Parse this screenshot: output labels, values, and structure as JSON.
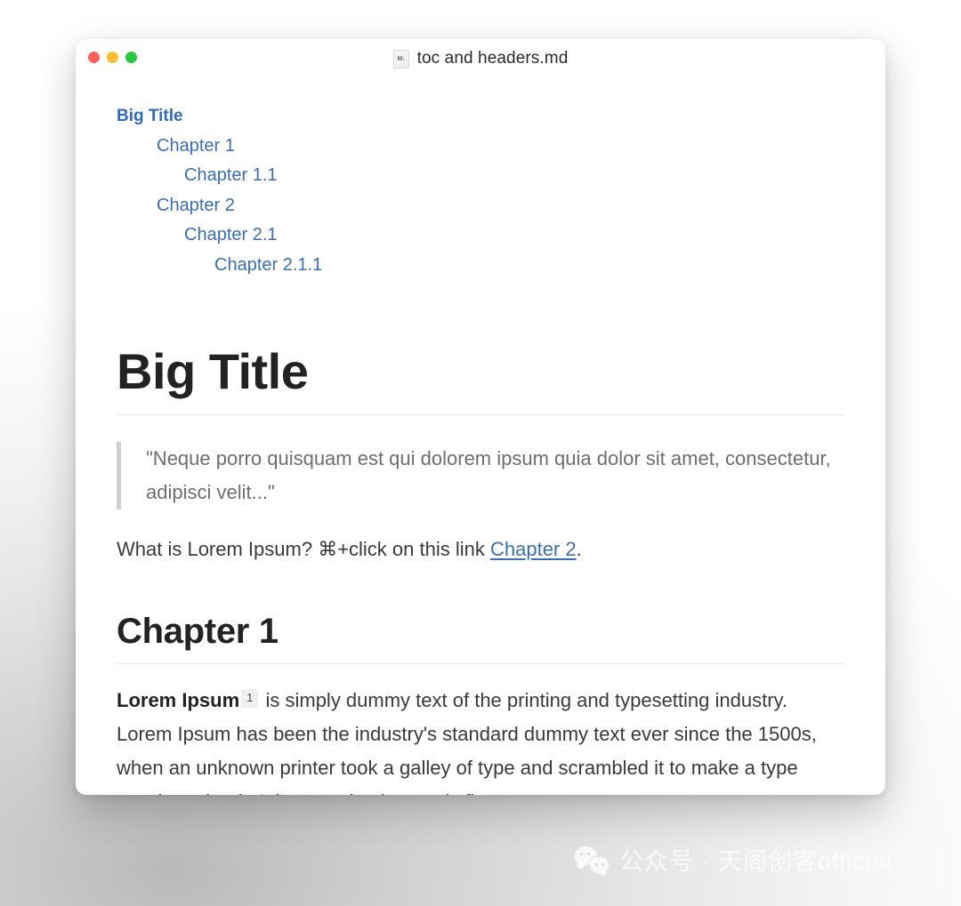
{
  "window": {
    "title": "toc and headers.md",
    "file_icon": "markdown-file-icon",
    "traffic_lights": [
      {
        "name": "close",
        "color": "#ff5f57"
      },
      {
        "name": "minimize",
        "color": "#febc2e"
      },
      {
        "name": "zoom",
        "color": "#28c840"
      }
    ]
  },
  "toc": {
    "items": [
      {
        "label": "Big Title",
        "level": 0
      },
      {
        "label": "Chapter 1",
        "level": 1
      },
      {
        "label": "Chapter 1.1",
        "level": 2
      },
      {
        "label": "Chapter 2",
        "level": 1
      },
      {
        "label": "Chapter 2.1",
        "level": 2
      },
      {
        "label": "Chapter 2.1.1",
        "level": 3
      }
    ]
  },
  "document": {
    "h1": "Big Title",
    "blockquote": "\"Neque porro quisquam est qui dolorem ipsum quia dolor sit amet, consectetur, adipisci velit...\"",
    "paragraph_link": {
      "before": "What is Lorem Ipsum? ⌘+click on this link ",
      "link_text": "Chapter 2",
      "after": "."
    },
    "h2": "Chapter 1",
    "body_paragraph": {
      "bold_lead": "Lorem Ipsum",
      "footnote_marker": "1",
      "rest": " is simply dummy text of the printing and typesetting industry. Lorem Ipsum has been the industry's standard dummy text ever since the 1500s, when an unknown printer took a galley of type and scrambled it to make a type specimen book. It has survived not only five"
    }
  },
  "watermark": {
    "text": "公众号 · 天阁创客official",
    "icon": "wechat-logo-icon"
  },
  "colors": {
    "link": "#3a6fb5",
    "heading": "#222222",
    "body_text": "#3a3a3a",
    "quote_text": "#6e6e6e",
    "quote_border": "#cfcfcf",
    "rule": "#eaeaea",
    "window_bg": "#ffffff"
  }
}
